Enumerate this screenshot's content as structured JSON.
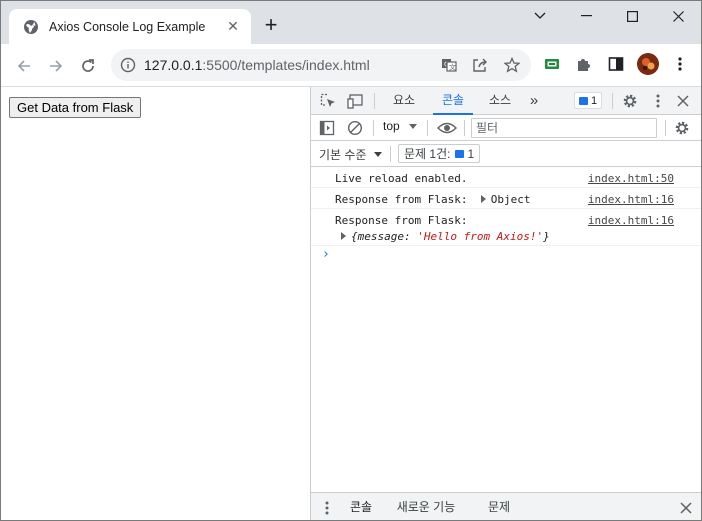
{
  "browser": {
    "tab_title": "Axios Console Log Example",
    "tab_close": "✕",
    "new_tab": "+",
    "url_host": "127.0.0.1",
    "url_rest": ":5500/templates/index.html"
  },
  "page": {
    "button_label": "Get Data from Flask"
  },
  "devtools": {
    "tabs": [
      "요소",
      "콘솔",
      "소스"
    ],
    "active_tab": "콘솔",
    "more_tabs": "»",
    "issues_badge_count": "1",
    "context": "top",
    "filter_placeholder": "필터",
    "levels_label": "기본 수준",
    "issues_label": "문제 1건:",
    "issues_count": "1",
    "messages": [
      {
        "text": "Live reload enabled.",
        "source": "index.html:50"
      },
      {
        "text": "Response from Flask:",
        "object": "Object",
        "source": "index.html:16"
      },
      {
        "text": "Response from Flask:",
        "source": "index.html:16",
        "expanded_key": "message",
        "expanded_value": "'Hello from Axios!'"
      }
    ],
    "prompt": "›",
    "drawer_tabs": [
      "콘솔",
      "새로운 기능",
      "문제"
    ],
    "drawer_active": "콘솔"
  },
  "colors": {
    "accent": "#1a73e8",
    "string_value": "#c41a16",
    "tabstrip_bg": "#dee1e6",
    "devtools_bar_bg": "#f1f3f4"
  },
  "icons": {
    "tab_favicon": "globe-icon",
    "back": "arrow-left-icon",
    "forward": "arrow-right-icon",
    "reload": "reload-icon",
    "site_info": "info-icon",
    "translate": "translate-icon",
    "share": "share-icon",
    "bookmark": "star-icon",
    "extensions": "puzzle-icon",
    "side_panel": "side-panel-icon",
    "menu": "kebab-menu-icon"
  }
}
